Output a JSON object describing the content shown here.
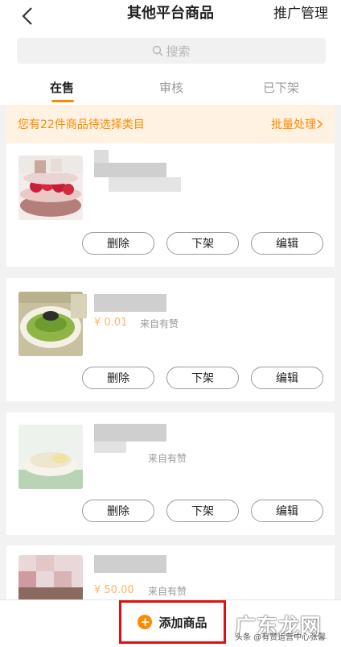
{
  "header": {
    "title": "其他平台商品",
    "promo": "推广管理"
  },
  "search": {
    "placeholder": "搜索"
  },
  "tabs": [
    {
      "label": "在售"
    },
    {
      "label": "审核"
    },
    {
      "label": "已下架"
    }
  ],
  "notice": {
    "text": "您有22件商品待选择类目",
    "action": "批量处理"
  },
  "products": [
    {
      "price": "",
      "source": ""
    },
    {
      "price": "¥ 0.01",
      "source": "来自有赞"
    },
    {
      "price": "",
      "source": "来自有赞"
    },
    {
      "price": "¥ 50.00",
      "source": "来自有赞"
    }
  ],
  "buttons": {
    "delete": "删除",
    "offshelf": "下架",
    "edit": "编辑"
  },
  "bottom": {
    "add": "添加商品"
  },
  "watermark": {
    "big": "广东龙网",
    "small": "头条 @有赞运营中心张馨"
  },
  "colors": {
    "accent": "#ff8a00",
    "highlight": "#e01010"
  }
}
